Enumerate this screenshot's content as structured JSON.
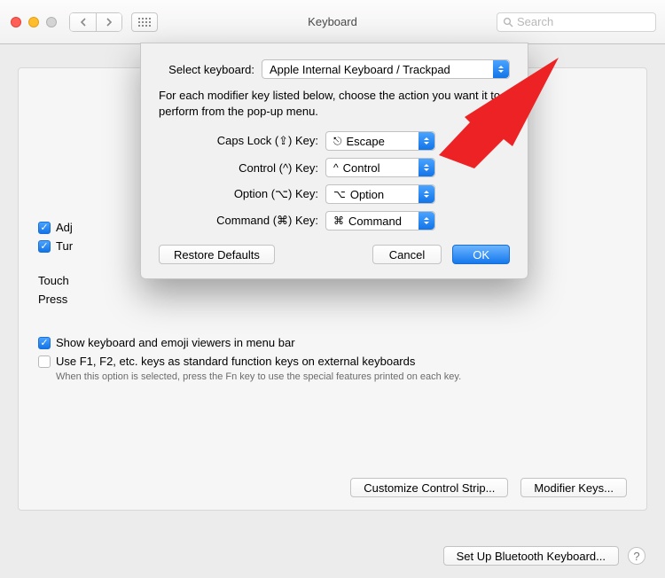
{
  "window": {
    "title": "Keyboard",
    "search_placeholder": "Search"
  },
  "panel": {
    "adj_label": "Adj",
    "turn_label": "Tur",
    "touch_label": "Touch",
    "press_label": "Press",
    "show_viewers": "Show keyboard and emoji viewers in menu bar",
    "fn_keys": "Use F1, F2, etc. keys as standard function keys on external keyboards",
    "fn_hint": "When this option is selected, press the Fn key to use the special features printed on each key.",
    "customize_btn": "Customize Control Strip...",
    "modifier_btn": "Modifier Keys..."
  },
  "footer": {
    "bluetooth_btn": "Set Up Bluetooth Keyboard..."
  },
  "sheet": {
    "select_label": "Select keyboard:",
    "select_value": "Apple Internal Keyboard / Trackpad",
    "instructions": "For each modifier key listed below, choose the action you want it to perform from the pop-up menu.",
    "rows": [
      {
        "label": "Caps Lock (⇪) Key:",
        "sym": "⎋",
        "value": "Escape"
      },
      {
        "label": "Control (^) Key:",
        "sym": "^",
        "value": "Control"
      },
      {
        "label": "Option (⌥) Key:",
        "sym": "⌥",
        "value": "Option"
      },
      {
        "label": "Command (⌘) Key:",
        "sym": "⌘",
        "value": "Command"
      }
    ],
    "restore_btn": "Restore Defaults",
    "cancel_btn": "Cancel",
    "ok_btn": "OK"
  }
}
